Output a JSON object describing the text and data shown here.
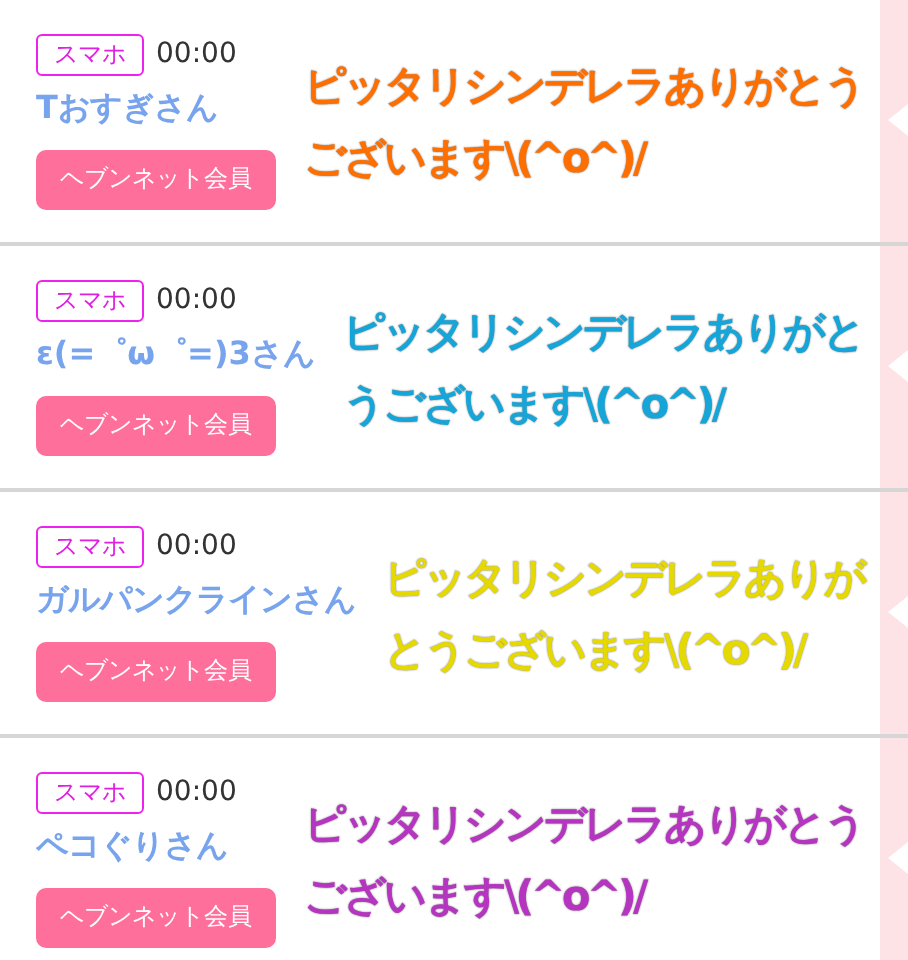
{
  "posts": [
    {
      "badge": "スマホ",
      "time": "00:00",
      "name": "Tおすぎさん",
      "member_button": "ヘブンネット会員",
      "message": "ピッタリシンデレラありがとうございます\\(^o^)/",
      "color": "#ff6f00"
    },
    {
      "badge": "スマホ",
      "time": "00:00",
      "name": "ε(=゜ω゜=)3さん",
      "member_button": "ヘブンネット会員",
      "message": "ピッタリシンデレラありがとうございます\\(^o^)/",
      "color": "#16a5d8"
    },
    {
      "badge": "スマホ",
      "time": "00:00",
      "name": "ガルパンクラインさん",
      "member_button": "ヘブンネット会員",
      "message": "ピッタリシンデレラありがとうございます\\(^o^)/",
      "color": "#e6d900"
    },
    {
      "badge": "スマホ",
      "time": "00:00",
      "name": "ペコぐりさん",
      "member_button": "ヘブンネット会員",
      "message": "ピッタリシンデレラありがとうございます\\(^o^)/",
      "color": "#b535c0"
    }
  ]
}
